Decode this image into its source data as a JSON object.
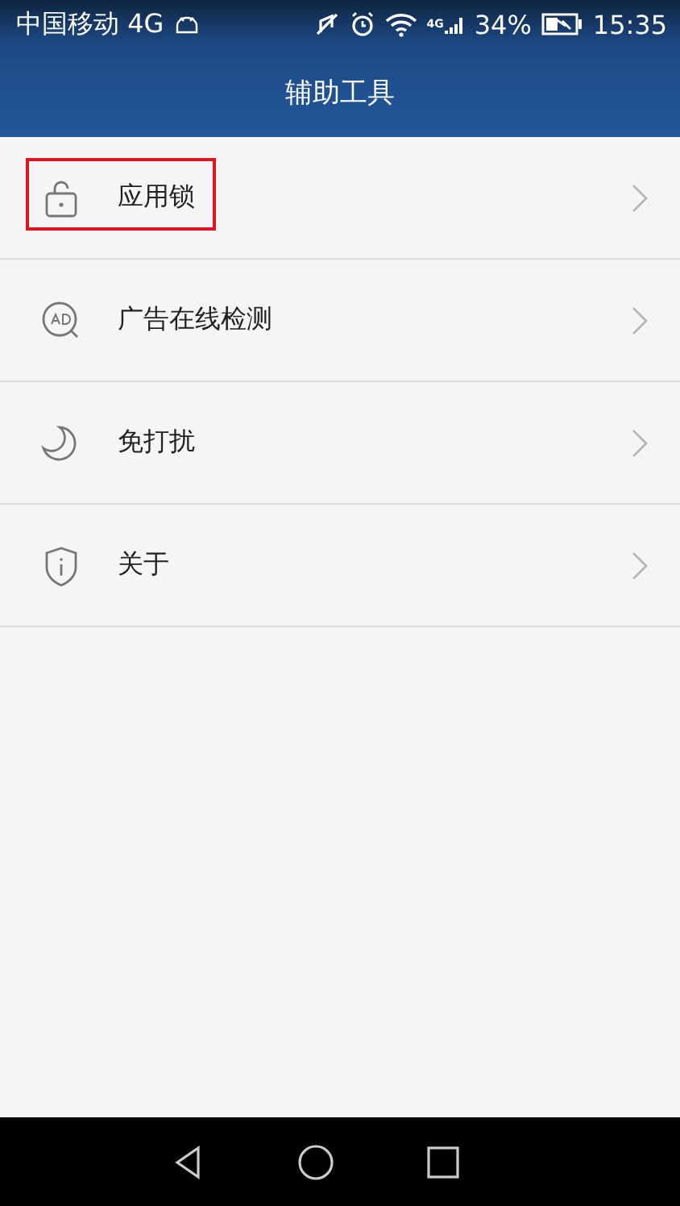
{
  "status_bar": {
    "carrier": "中国移动 4G",
    "network_label": "4G",
    "battery": "34%",
    "time": "15:35"
  },
  "header": {
    "title": "辅助工具"
  },
  "items": [
    {
      "kind": "lock",
      "label": "应用锁",
      "highlighted": true
    },
    {
      "kind": "ad",
      "label": "广告在线检测",
      "highlighted": false
    },
    {
      "kind": "moon",
      "label": "免打扰",
      "highlighted": false
    },
    {
      "kind": "shield",
      "label": "关于",
      "highlighted": false
    }
  ]
}
